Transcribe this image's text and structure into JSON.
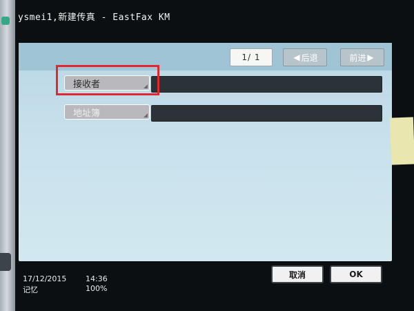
{
  "window": {
    "title": "ysmei1,新建传真 - EastFax KM"
  },
  "pager": {
    "page_text": "1/  1",
    "prev_label": "后退",
    "next_label": "前进",
    "prev_icon": "arrow-left-icon",
    "next_icon": "arrow-right-icon"
  },
  "fields": {
    "recipient_label": "接收者",
    "recipient_value": "",
    "address_book_label": "地址簿",
    "address_book_value": ""
  },
  "status": {
    "date": "17/12/2015",
    "time": "14:36",
    "memory_label": "记忆",
    "memory_value": "100%"
  },
  "actions": {
    "cancel_label": "取消",
    "ok_label": "OK"
  },
  "colors": {
    "highlight": "#e0282e",
    "panel_bg": "#c8e1ec"
  }
}
